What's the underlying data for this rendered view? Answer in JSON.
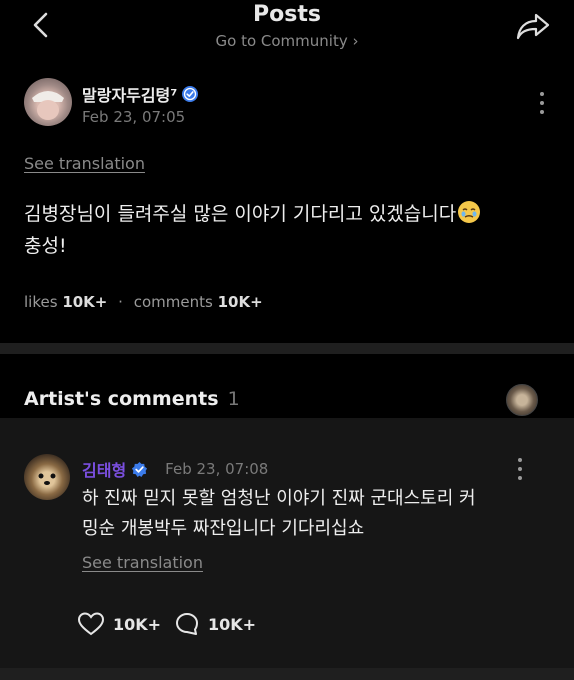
{
  "header": {
    "title": "Posts",
    "subtitle": "Go to Community",
    "subtitle_arrow": "›"
  },
  "post": {
    "author": "말랑자두김텽⁷",
    "timestamp": "Feb 23, 07:05",
    "see_translation": "See translation",
    "text_line1": "김병장님이 들려주실 많은 이야기 기다리고 있겠습니다",
    "text_line2": "충성!",
    "likes_label": "likes",
    "likes_count": "10K+",
    "dot": "·",
    "comments_label": "comments",
    "comments_count": "10K+"
  },
  "artist_comments": {
    "title": "Artist's comments",
    "count": "1",
    "comment": {
      "author": "김태형",
      "timestamp": "Feb 23, 07:08",
      "text_line1": "하 진짜 믿지 못할 엄청난 이야기 진짜 군대스토리 커",
      "text_line2": "밍순 개봉박두 짜잔입니다 기다리십쇼",
      "see_translation": "See translation",
      "likes": "10K+",
      "replies": "10K+"
    }
  },
  "colors": {
    "background": "#000000",
    "artist_accent": "#7b4fe0",
    "verified": "#3b7bea",
    "separator": "#1f1f1f"
  },
  "icons": [
    "back-arrow-icon",
    "share-icon",
    "verified-icon",
    "more-icon",
    "smile-tear-emoji",
    "heart-icon",
    "comment-icon"
  ]
}
